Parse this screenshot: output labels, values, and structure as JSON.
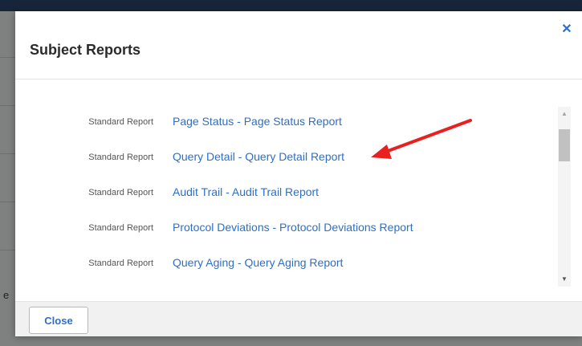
{
  "modal": {
    "title": "Subject Reports",
    "close_icon": "close-icon",
    "close_glyph": "✕"
  },
  "reports": [
    {
      "type": "Standard Report",
      "label": "Page Status - Page Status Report"
    },
    {
      "type": "Standard Report",
      "label": "Query Detail - Query Detail Report"
    },
    {
      "type": "Standard Report",
      "label": "Audit Trail - Audit Trail Report"
    },
    {
      "type": "Standard Report",
      "label": "Protocol Deviations - Protocol Deviations Report"
    },
    {
      "type": "Standard Report",
      "label": "Query Aging - Query Aging Report"
    }
  ],
  "footer": {
    "close_label": "Close"
  },
  "backdrop": {
    "partial_text": "e"
  },
  "annotation": {
    "arrow_color": "#e8201f",
    "target": "Query Detail - Query Detail Report"
  },
  "colors": {
    "link": "#2d6fc8",
    "topbar": "#17253a"
  }
}
